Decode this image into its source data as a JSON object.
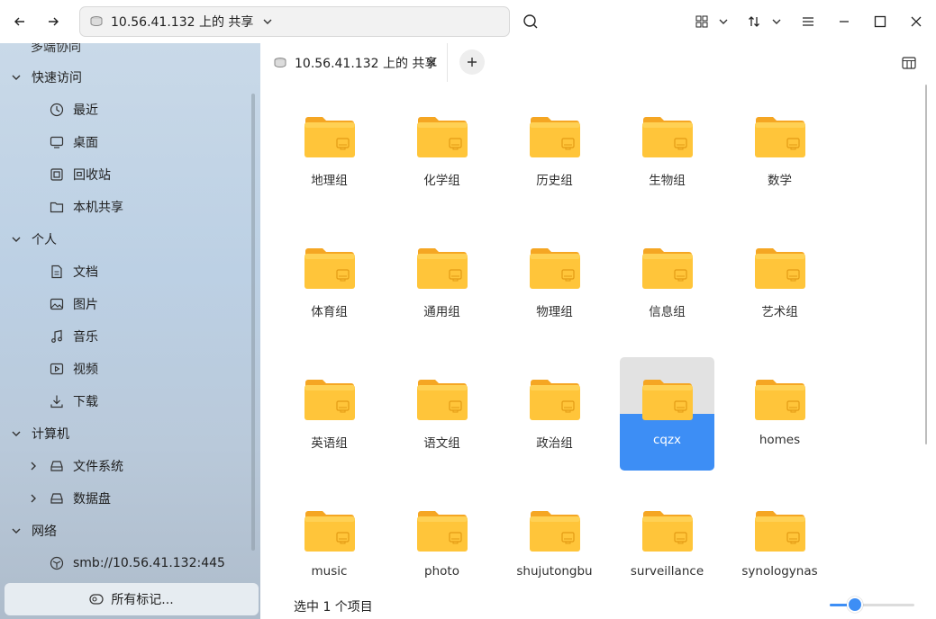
{
  "toolbar": {
    "address": "10.56.41.132 上的 共享"
  },
  "sidebar": {
    "cut_off_item": "多端协同",
    "sections": [
      {
        "label": "快速访问",
        "items": [
          "最近",
          "桌面",
          "回收站",
          "本机共享"
        ],
        "icons": [
          "clock-icon",
          "desktop-icon",
          "trash-icon",
          "folder-icon"
        ]
      },
      {
        "label": "个人",
        "items": [
          "文档",
          "图片",
          "音乐",
          "视频",
          "下载"
        ],
        "icons": [
          "document-icon",
          "picture-icon",
          "music-icon",
          "video-icon",
          "download-icon"
        ]
      },
      {
        "label": "计算机",
        "items": [
          "文件系统",
          "数据盘"
        ],
        "icons": [
          "disk-icon",
          "disk-icon"
        ]
      },
      {
        "label": "网络",
        "items": [
          "smb://10.56.41.132:445"
        ],
        "icons": [
          "network-icon"
        ]
      }
    ],
    "tags_button": "所有标记..."
  },
  "tabs": [
    {
      "label": "10.56.41.132 上的 共享"
    }
  ],
  "folders": [
    "地理组",
    "化学组",
    "历史组",
    "生物组",
    "数学",
    "体育组",
    "通用组",
    "物理组",
    "信息组",
    "艺术组",
    "英语组",
    "语文组",
    "政治组",
    "cqzx",
    "homes",
    "music",
    "photo",
    "shujutongbu",
    "surveillance",
    "synologynas"
  ],
  "selected_folder": "cqzx",
  "status": {
    "text": "选中 1 个项目",
    "zoom_level": 0.3
  },
  "colors": {
    "accent": "#3d8ef5",
    "folder": "#ffc53a"
  }
}
